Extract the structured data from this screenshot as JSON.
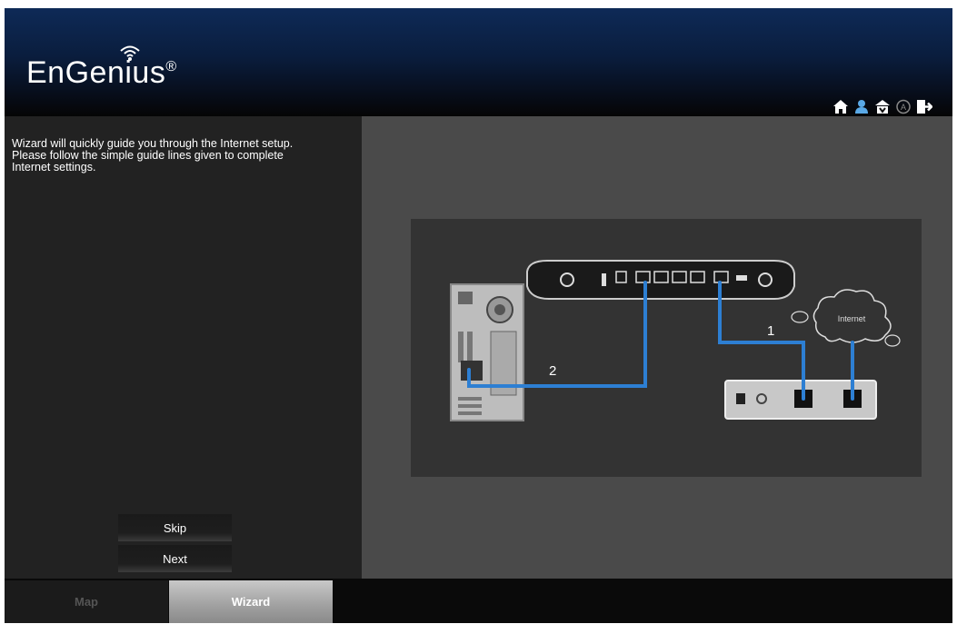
{
  "header": {
    "brand": "EnGenius",
    "registered_mark": "®",
    "icons": [
      "home-icon",
      "user-icon",
      "firmware-upload-icon",
      "auto-icon",
      "logout-icon"
    ]
  },
  "left_panel": {
    "intro_lines": [
      "Wizard will quickly guide you through the Internet setup.",
      "Please follow the simple guide lines given to complete",
      "Internet settings."
    ],
    "skip_label": "Skip",
    "next_label": "Next"
  },
  "diagram": {
    "cloud_label": "Internet",
    "step1_label": "1",
    "step2_label": "2",
    "cable_color": "#2d7fd3"
  },
  "tabs": [
    {
      "label": "Map",
      "selected": false
    },
    {
      "label": "Wizard",
      "selected": true
    }
  ]
}
